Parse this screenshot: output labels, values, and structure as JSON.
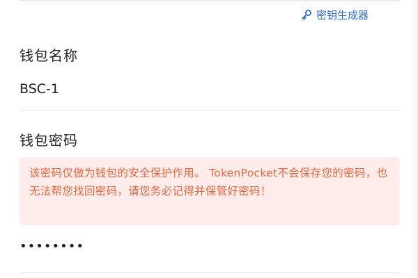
{
  "header": {
    "keygen_label": "密钥生成器"
  },
  "wallet_name": {
    "label": "钱包名称",
    "value": "BSC-1"
  },
  "wallet_password": {
    "label": "钱包密码",
    "warning": "该密码仅做为钱包的安全保护作用。 TokenPocket不会保存您的密码，也无法帮您找回密码，请您务必记得并保管好密码！",
    "value": "••••••••"
  },
  "colors": {
    "accent": "#2f6fd0",
    "warning_text": "#e8663d",
    "warning_bg": "#fdecea"
  },
  "icons": {
    "keygen": "key-icon"
  }
}
